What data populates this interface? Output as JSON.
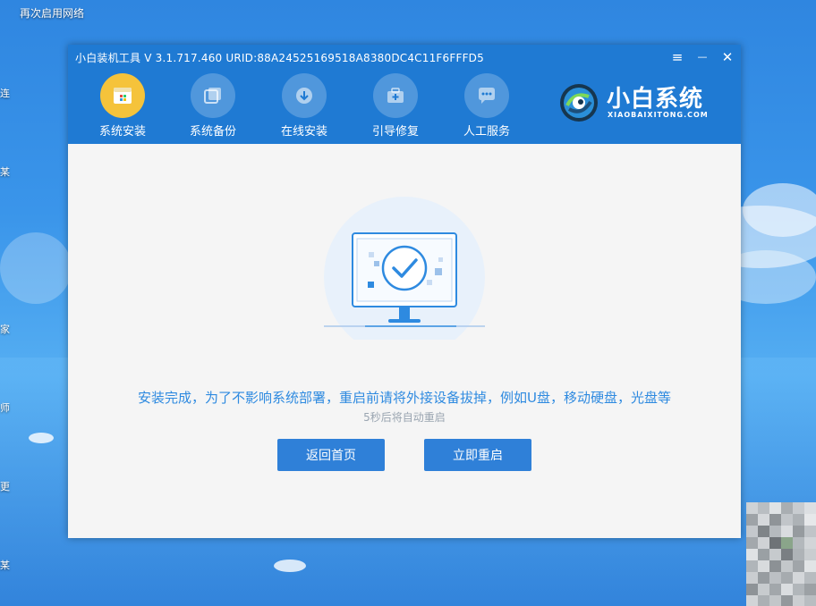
{
  "desktop": {
    "icon_label": "再次启用网络",
    "edge_labels": [
      "连",
      "某",
      "家",
      "师",
      "更",
      "某"
    ]
  },
  "window": {
    "title": "小白装机工具 V 3.1.717.460 URID:88A24525169518A8380DC4C11F6FFFD5",
    "controls": {
      "menu": "≡",
      "minimize": "—",
      "close": "✕"
    }
  },
  "nav": {
    "items": [
      {
        "label": "系统安装",
        "icon": "system-install-icon",
        "active": true
      },
      {
        "label": "系统备份",
        "icon": "system-backup-icon",
        "active": false
      },
      {
        "label": "在线安装",
        "icon": "online-install-icon",
        "active": false
      },
      {
        "label": "引导修复",
        "icon": "boot-repair-icon",
        "active": false
      },
      {
        "label": "人工服务",
        "icon": "chat-service-icon",
        "active": false
      }
    ]
  },
  "brand": {
    "name": "小白系统",
    "subtitle": "XIAOBAIXITONG.COM"
  },
  "content": {
    "message": "安装完成，为了不影响系统部署，重启前请将外接设备拔掉，例如U盘，移动硬盘，光盘等",
    "countdown": "5秒后将自动重启",
    "buttons": {
      "back_home": "返回首页",
      "restart_now": "立即重启"
    }
  },
  "colors": {
    "header": "#1f7ad3",
    "accent": "#2e8ae0",
    "active_nav": "#f5c33b"
  }
}
